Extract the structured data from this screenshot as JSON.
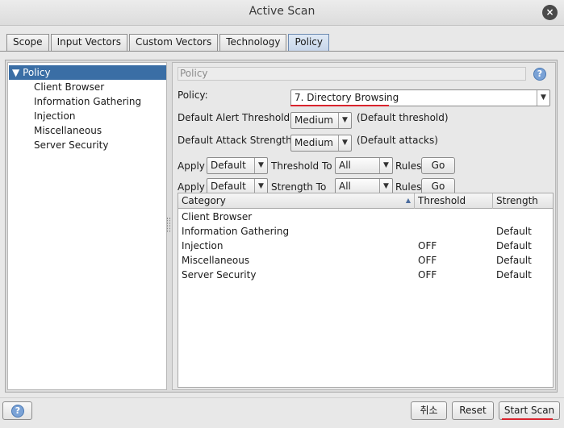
{
  "window": {
    "title": "Active Scan",
    "close_icon": "×"
  },
  "tabs": [
    {
      "label": "Scope"
    },
    {
      "label": "Input Vectors"
    },
    {
      "label": "Custom Vectors"
    },
    {
      "label": "Technology"
    },
    {
      "label": "Policy"
    }
  ],
  "tree": {
    "root": "Policy",
    "expander": "▼",
    "children": [
      "Client Browser",
      "Information Gathering",
      "Injection",
      "Miscellaneous",
      "Server Security"
    ]
  },
  "panel": {
    "header": "Policy",
    "help_icon": "?",
    "policy_label": "Policy:",
    "policy_value": "7. Directory Browsing",
    "alert_threshold_label": "Default Alert Threshold:",
    "alert_threshold_value": "Medium",
    "alert_threshold_hint": "(Default threshold)",
    "attack_strength_label": "Default Attack Strength:",
    "attack_strength_value": "Medium",
    "attack_strength_hint": "(Default attacks)",
    "apply_label": "Apply",
    "row1": {
      "apply_value": "Default",
      "to_label": "Threshold To",
      "to_value": "All",
      "rules_label": "Rules",
      "go_label": "Go"
    },
    "row2": {
      "apply_value": "Default",
      "to_label": "Strength To",
      "to_value": "All",
      "rules_label": "Rules",
      "go_label": "Go"
    },
    "dropdown_arrow": "▼"
  },
  "table": {
    "headers": {
      "category": "Category",
      "threshold": "Threshold",
      "strength": "Strength"
    },
    "sort_indicator": "▲",
    "rows": [
      {
        "category": "Client Browser",
        "threshold": "",
        "strength": ""
      },
      {
        "category": "Information Gathering",
        "threshold": "",
        "strength": "Default"
      },
      {
        "category": "Injection",
        "threshold": "OFF",
        "strength": "Default"
      },
      {
        "category": "Miscellaneous",
        "threshold": "OFF",
        "strength": "Default"
      },
      {
        "category": "Server Security",
        "threshold": "OFF",
        "strength": "Default"
      }
    ]
  },
  "footer": {
    "help_icon": "?",
    "cancel_label": "취소",
    "reset_label": "Reset",
    "start_label": "Start Scan"
  },
  "colors": {
    "accent_underline": "#d9232d",
    "selection": "#3a6ea5"
  }
}
